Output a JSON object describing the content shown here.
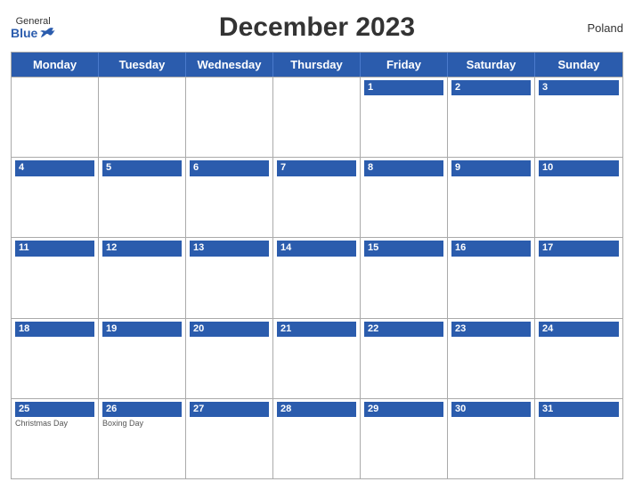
{
  "header": {
    "title": "December 2023",
    "country": "Poland",
    "logo_general": "General",
    "logo_blue": "Blue"
  },
  "days_of_week": [
    "Monday",
    "Tuesday",
    "Wednesday",
    "Thursday",
    "Friday",
    "Saturday",
    "Sunday"
  ],
  "weeks": [
    [
      {
        "num": "",
        "empty": true
      },
      {
        "num": "",
        "empty": true
      },
      {
        "num": "",
        "empty": true
      },
      {
        "num": "",
        "empty": true
      },
      {
        "num": "1"
      },
      {
        "num": "2"
      },
      {
        "num": "3"
      }
    ],
    [
      {
        "num": "4"
      },
      {
        "num": "5"
      },
      {
        "num": "6"
      },
      {
        "num": "7"
      },
      {
        "num": "8"
      },
      {
        "num": "9"
      },
      {
        "num": "10"
      }
    ],
    [
      {
        "num": "11"
      },
      {
        "num": "12"
      },
      {
        "num": "13"
      },
      {
        "num": "14"
      },
      {
        "num": "15"
      },
      {
        "num": "16"
      },
      {
        "num": "17"
      }
    ],
    [
      {
        "num": "18"
      },
      {
        "num": "19"
      },
      {
        "num": "20"
      },
      {
        "num": "21"
      },
      {
        "num": "22"
      },
      {
        "num": "23"
      },
      {
        "num": "24"
      }
    ],
    [
      {
        "num": "25",
        "event": "Christmas Day"
      },
      {
        "num": "26",
        "event": "Boxing Day"
      },
      {
        "num": "27"
      },
      {
        "num": "28"
      },
      {
        "num": "29"
      },
      {
        "num": "30"
      },
      {
        "num": "31"
      }
    ]
  ]
}
